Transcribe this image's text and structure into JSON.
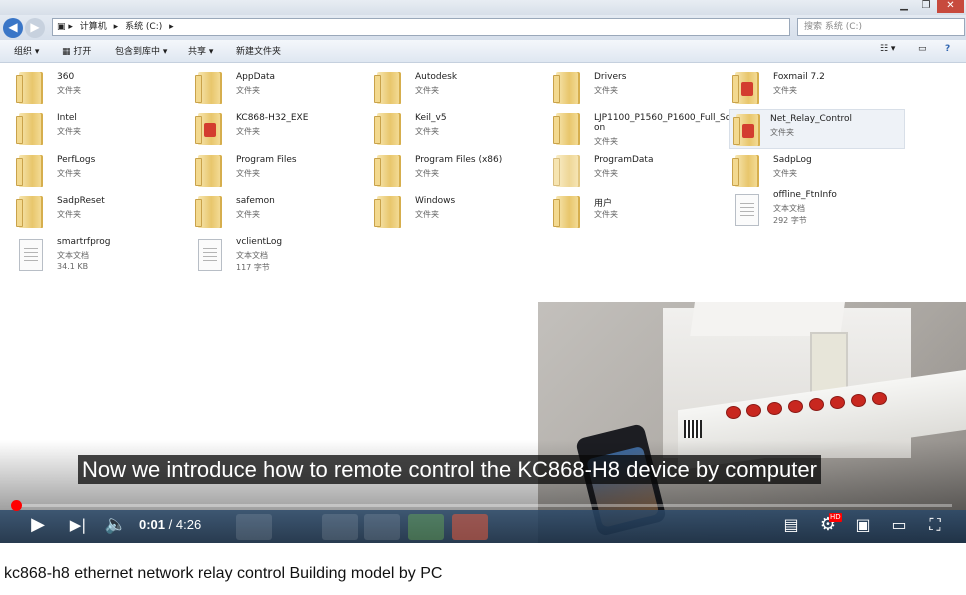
{
  "explorer": {
    "path": [
      "计算机",
      "系统 (C:)"
    ],
    "search_placeholder": "搜索 系统 (C:)",
    "toolbar": {
      "organize": "组织 ▾",
      "open": "打开",
      "include_in_library": "包含到库中 ▾",
      "share": "共享 ▾",
      "new_folder": "新建文件夹"
    },
    "files": [
      {
        "name": "360",
        "type": "文件夹",
        "kind": "folder"
      },
      {
        "name": "AppData",
        "type": "文件夹",
        "kind": "folder"
      },
      {
        "name": "Autodesk",
        "type": "文件夹",
        "kind": "folder"
      },
      {
        "name": "Drivers",
        "type": "文件夹",
        "kind": "folder"
      },
      {
        "name": "Foxmail 7.2",
        "type": "文件夹",
        "kind": "folder"
      },
      {
        "name": "Intel",
        "type": "文件夹",
        "kind": "folder"
      },
      {
        "name": "KC868-H32_EXE",
        "type": "文件夹",
        "kind": "folder"
      },
      {
        "name": "Keil_v5",
        "type": "文件夹",
        "kind": "folder"
      },
      {
        "name": "LJP1100_P1560_P1600_Full_Soluti",
        "name2": "on",
        "type": "文件夹",
        "kind": "folder"
      },
      {
        "name": "Net_Relay_Control",
        "type": "文件夹",
        "kind": "folder"
      },
      {
        "name": "PerfLogs",
        "type": "文件夹",
        "kind": "folder"
      },
      {
        "name": "Program Files",
        "type": "文件夹",
        "kind": "folder"
      },
      {
        "name": "Program Files (x86)",
        "type": "文件夹",
        "kind": "folder"
      },
      {
        "name": "ProgramData",
        "type": "文件夹",
        "kind": "folder"
      },
      {
        "name": "SadpLog",
        "type": "文件夹",
        "kind": "folder"
      },
      {
        "name": "SadpReset",
        "type": "文件夹",
        "kind": "folder"
      },
      {
        "name": "safemon",
        "type": "文件夹",
        "kind": "folder"
      },
      {
        "name": "Windows",
        "type": "文件夹",
        "kind": "folder"
      },
      {
        "name": "用户",
        "type": "文件夹",
        "kind": "folder"
      },
      {
        "name": "offline_FtnInfo",
        "type": "文本文档",
        "size": "292 字节",
        "kind": "document"
      },
      {
        "name": "smartrfprog",
        "type": "文本文档",
        "size": "34.1 KB",
        "kind": "document"
      },
      {
        "name": "vclientLog",
        "type": "文本文档",
        "size": "117 字节",
        "kind": "document"
      }
    ]
  },
  "player": {
    "caption": "Now we introduce how to remote control the KC868-H8 device by computer",
    "current_time": "0:01",
    "separator": " / ",
    "duration": "4:26",
    "progress_fraction": 0.004,
    "hd_badge": "HD",
    "progress_color": "#ff0000"
  },
  "video_title": "kc868-h8 ethernet network relay control Building model by PC"
}
